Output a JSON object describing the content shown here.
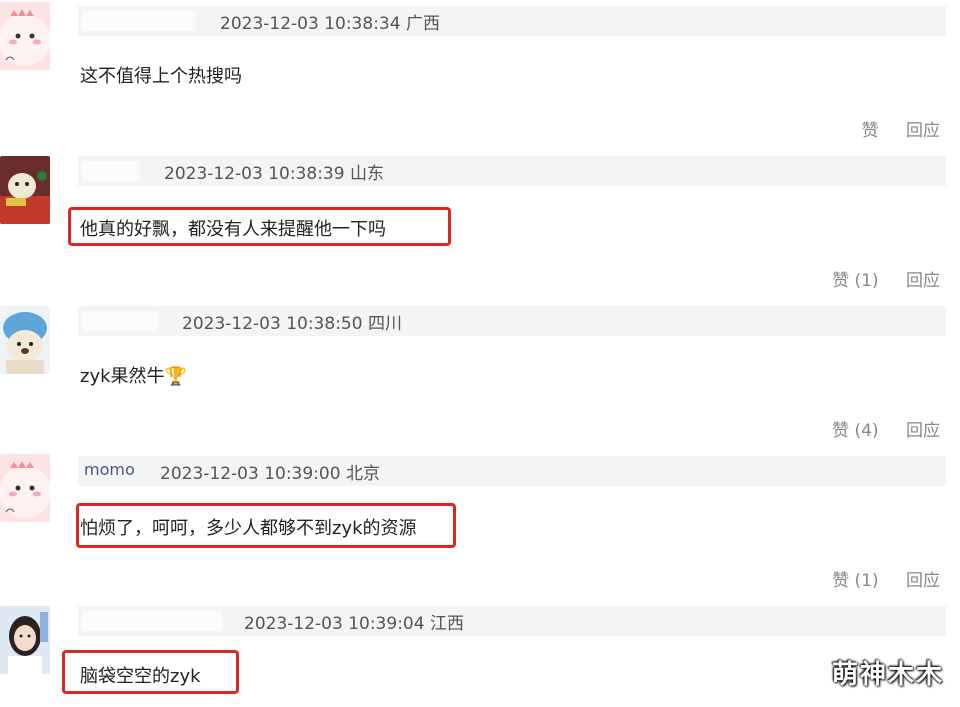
{
  "comments": [
    {
      "username": "",
      "timestamp": "2023-12-03 10:38:34",
      "location": "广西",
      "text": "这不值得上个热搜吗",
      "like_label": "赞",
      "like_count": "",
      "reply_label": "回应",
      "highlighted": false
    },
    {
      "username": "",
      "timestamp": "2023-12-03 10:38:39",
      "location": "山东",
      "text": "他真的好飘，都没有人来提醒他一下吗",
      "like_label": "赞",
      "like_count": "(1)",
      "reply_label": "回应",
      "highlighted": true
    },
    {
      "username": "",
      "timestamp": "2023-12-03 10:38:50",
      "location": "四川",
      "text": "zyk果然牛🏆",
      "like_label": "赞",
      "like_count": "(4)",
      "reply_label": "回应",
      "highlighted": false
    },
    {
      "username": "momo",
      "timestamp": "2023-12-03 10:39:00",
      "location": "北京",
      "text": "怕烦了，呵呵，多少人都够不到zyk的资源",
      "like_label": "赞",
      "like_count": "(1)",
      "reply_label": "回应",
      "highlighted": true
    },
    {
      "username": "",
      "timestamp": "2023-12-03 10:39:04",
      "location": "江西",
      "text": "脑袋空空的zyk",
      "like_label": "",
      "like_count": "",
      "reply_label": "",
      "highlighted": true
    }
  ],
  "watermark": "萌神木木",
  "colors": {
    "highlight": "#d62a22",
    "meta_bg": "#f3f4f5",
    "username": "#4a5a7a"
  },
  "icons": [
    "pink-dino-avatar",
    "plush-toy-avatar",
    "blue-bear-avatar",
    "pink-dino-avatar",
    "girl-photo-avatar"
  ]
}
